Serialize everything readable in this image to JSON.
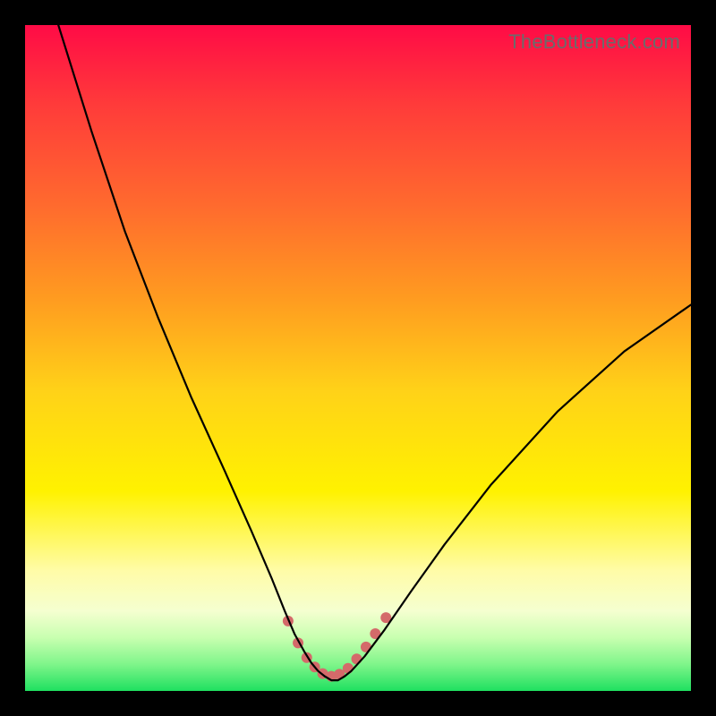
{
  "watermark": {
    "text": "TheBottleneck.com"
  },
  "chart_data": {
    "type": "line",
    "title": "",
    "xlabel": "",
    "ylabel": "",
    "xlim": [
      0,
      100
    ],
    "ylim": [
      0,
      100
    ],
    "grid": false,
    "legend": false,
    "background_gradient": {
      "orientation": "vertical",
      "stops": [
        {
          "pos": 0.0,
          "color": "#ff0b46"
        },
        {
          "pos": 0.27,
          "color": "#ff6a2e"
        },
        {
          "pos": 0.55,
          "color": "#ffd218"
        },
        {
          "pos": 0.7,
          "color": "#fff200"
        },
        {
          "pos": 0.88,
          "color": "#f5ffd0"
        },
        {
          "pos": 1.0,
          "color": "#1fe060"
        }
      ]
    },
    "series": [
      {
        "name": "bottleneck-curve",
        "color": "#000000",
        "x": [
          5,
          10,
          15,
          20,
          25,
          30,
          34,
          37,
          39,
          40.5,
          42,
          43,
          44,
          45,
          46,
          47,
          48,
          49,
          51,
          54,
          58,
          63,
          70,
          80,
          90,
          100
        ],
        "y": [
          100,
          84,
          69,
          56,
          44,
          33,
          24,
          17,
          12,
          8.5,
          5.8,
          4.2,
          3.0,
          2.2,
          1.6,
          1.6,
          2.2,
          3.0,
          5.2,
          9.2,
          15,
          22,
          31,
          42,
          51,
          58
        ]
      }
    ],
    "markers": {
      "name": "highlight-dots",
      "color": "#d46a6a",
      "radius": 6,
      "points": [
        {
          "x": 39.5,
          "y": 10.5
        },
        {
          "x": 41.0,
          "y": 7.2
        },
        {
          "x": 42.3,
          "y": 5.0
        },
        {
          "x": 43.5,
          "y": 3.6
        },
        {
          "x": 44.7,
          "y": 2.6
        },
        {
          "x": 46.0,
          "y": 2.2
        },
        {
          "x": 47.2,
          "y": 2.5
        },
        {
          "x": 48.5,
          "y": 3.4
        },
        {
          "x": 49.8,
          "y": 4.8
        },
        {
          "x": 51.2,
          "y": 6.6
        },
        {
          "x": 52.6,
          "y": 8.6
        },
        {
          "x": 54.2,
          "y": 11.0
        }
      ]
    }
  }
}
